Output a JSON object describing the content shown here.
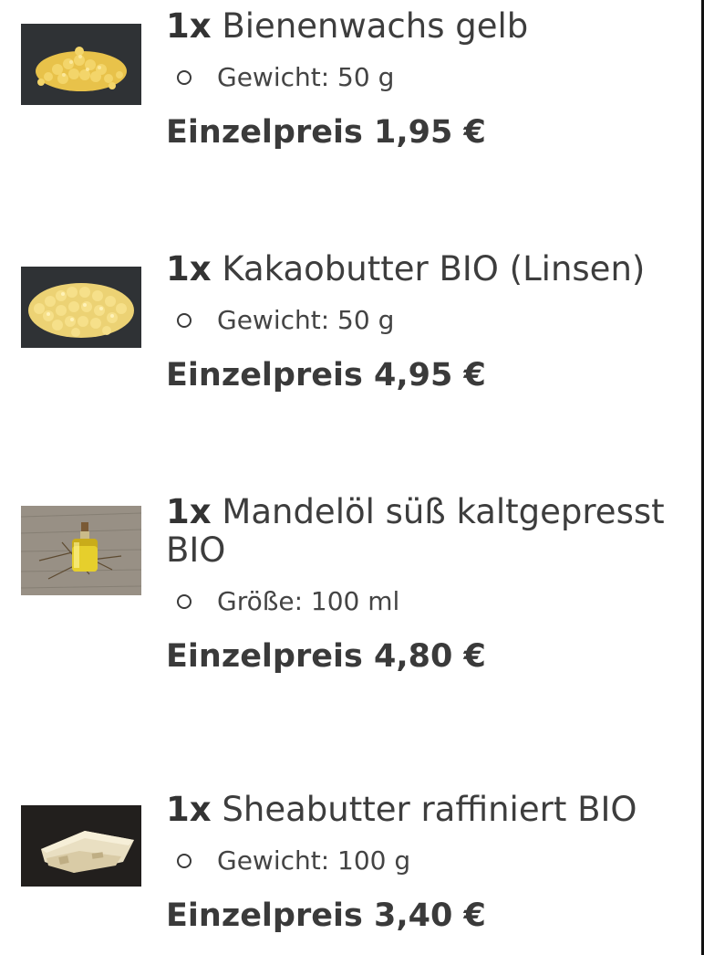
{
  "items": [
    {
      "image_icon": "beeswax-pellets-image",
      "qty": "1x",
      "name": "Bienenwachs gelb",
      "variant": "Gewicht: 50 g",
      "price": "Einzelpreis 1,95 €"
    },
    {
      "image_icon": "cocoa-butter-pellets-image",
      "qty": "1x",
      "name": "Kakaobutter BIO (Linsen)",
      "variant": "Gewicht: 50 g",
      "price": "Einzelpreis 4,95 €"
    },
    {
      "image_icon": "almond-oil-bottle-image",
      "qty": "1x",
      "name": "Mandelöl süß kaltgepresst BIO",
      "variant": "Größe: 100 ml",
      "price": "Einzelpreis 4,80 €"
    },
    {
      "image_icon": "shea-butter-block-image",
      "qty": "1x",
      "name": "Sheabutter raffiniert BIO",
      "variant": "Gewicht: 100 g",
      "price": "Einzelpreis 3,40 €"
    }
  ]
}
